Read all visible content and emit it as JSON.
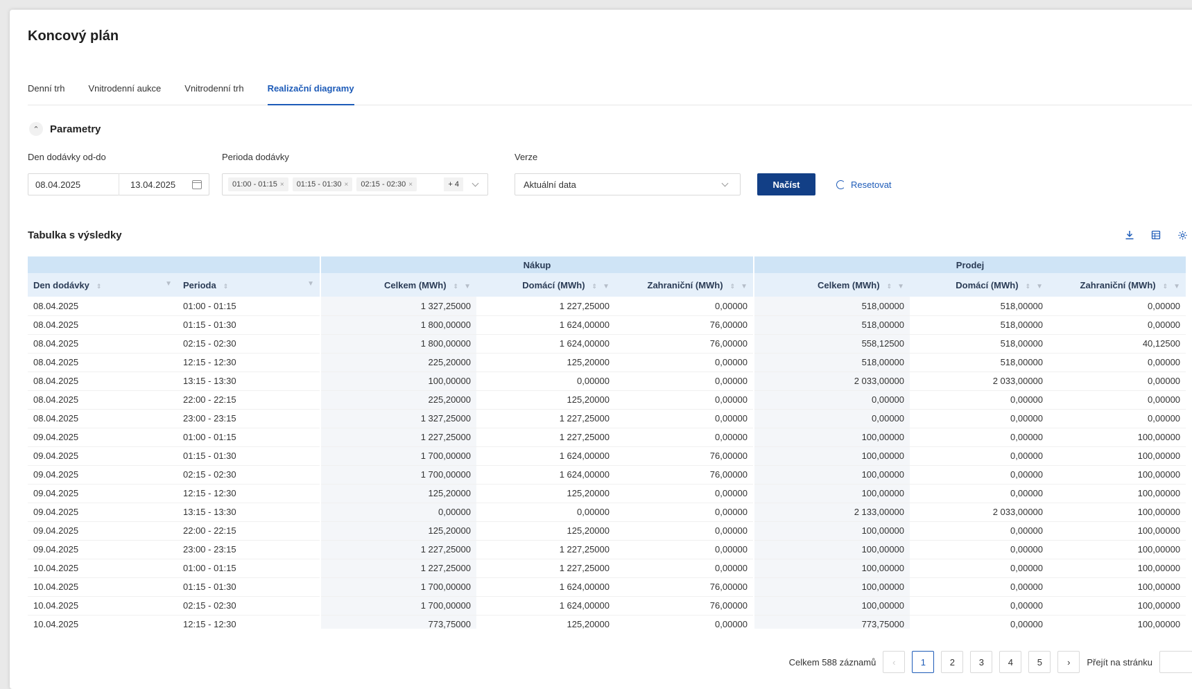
{
  "page": {
    "title": "Koncový plán"
  },
  "tabs": [
    "Denní trh",
    "Vnitrodenní aukce",
    "Vnitrodenní trh",
    "Realizační diagramy"
  ],
  "active_tab": "Realizační diagramy",
  "params": {
    "title": "Parametry",
    "date_label": "Den dodávky od-do",
    "date_from": "08.04.2025",
    "date_to": "13.04.2025",
    "period_label": "Perioda dodávky",
    "period_chips": [
      "01:00 - 01:15",
      "01:15 - 01:30",
      "02:15 - 02:30"
    ],
    "period_more": "+ 4",
    "version_label": "Verze",
    "version_value": "Aktuální data",
    "load_button": "Načíst",
    "reset_button": "Resetovat"
  },
  "results": {
    "title": "Tabulka s výsledky",
    "group_headers": {
      "buy": "Nákup",
      "sell": "Prodej"
    },
    "columns": [
      "Den dodávky",
      "Perioda",
      "Celkem (MWh)",
      "Domácí (MWh)",
      "Zahraniční (MWh)",
      "Celkem (MWh)",
      "Domácí (MWh)",
      "Zahraniční (MWh)"
    ],
    "rows": [
      [
        "08.04.2025",
        "01:00 - 01:15",
        "1 327,25000",
        "1 227,25000",
        "0,00000",
        "518,00000",
        "518,00000",
        "0,00000"
      ],
      [
        "08.04.2025",
        "01:15 - 01:30",
        "1 800,00000",
        "1 624,00000",
        "76,00000",
        "518,00000",
        "518,00000",
        "0,00000"
      ],
      [
        "08.04.2025",
        "02:15 - 02:30",
        "1 800,00000",
        "1 624,00000",
        "76,00000",
        "558,12500",
        "518,00000",
        "40,12500"
      ],
      [
        "08.04.2025",
        "12:15 - 12:30",
        "225,20000",
        "125,20000",
        "0,00000",
        "518,00000",
        "518,00000",
        "0,00000"
      ],
      [
        "08.04.2025",
        "13:15 - 13:30",
        "100,00000",
        "0,00000",
        "0,00000",
        "2 033,00000",
        "2 033,00000",
        "0,00000"
      ],
      [
        "08.04.2025",
        "22:00 - 22:15",
        "225,20000",
        "125,20000",
        "0,00000",
        "0,00000",
        "0,00000",
        "0,00000"
      ],
      [
        "08.04.2025",
        "23:00 - 23:15",
        "1 327,25000",
        "1 227,25000",
        "0,00000",
        "0,00000",
        "0,00000",
        "0,00000"
      ],
      [
        "09.04.2025",
        "01:00 - 01:15",
        "1 227,25000",
        "1 227,25000",
        "0,00000",
        "100,00000",
        "0,00000",
        "100,00000"
      ],
      [
        "09.04.2025",
        "01:15 - 01:30",
        "1 700,00000",
        "1 624,00000",
        "76,00000",
        "100,00000",
        "0,00000",
        "100,00000"
      ],
      [
        "09.04.2025",
        "02:15 - 02:30",
        "1 700,00000",
        "1 624,00000",
        "76,00000",
        "100,00000",
        "0,00000",
        "100,00000"
      ],
      [
        "09.04.2025",
        "12:15 - 12:30",
        "125,20000",
        "125,20000",
        "0,00000",
        "100,00000",
        "0,00000",
        "100,00000"
      ],
      [
        "09.04.2025",
        "13:15 - 13:30",
        "0,00000",
        "0,00000",
        "0,00000",
        "2 133,00000",
        "2 033,00000",
        "100,00000"
      ],
      [
        "09.04.2025",
        "22:00 - 22:15",
        "125,20000",
        "125,20000",
        "0,00000",
        "100,00000",
        "0,00000",
        "100,00000"
      ],
      [
        "09.04.2025",
        "23:00 - 23:15",
        "1 227,25000",
        "1 227,25000",
        "0,00000",
        "100,00000",
        "0,00000",
        "100,00000"
      ],
      [
        "10.04.2025",
        "01:00 - 01:15",
        "1 227,25000",
        "1 227,25000",
        "0,00000",
        "100,00000",
        "0,00000",
        "100,00000"
      ],
      [
        "10.04.2025",
        "01:15 - 01:30",
        "1 700,00000",
        "1 624,00000",
        "76,00000",
        "100,00000",
        "0,00000",
        "100,00000"
      ],
      [
        "10.04.2025",
        "02:15 - 02:30",
        "1 700,00000",
        "1 624,00000",
        "76,00000",
        "100,00000",
        "0,00000",
        "100,00000"
      ],
      [
        "10.04.2025",
        "12:15 - 12:30",
        "773,75000",
        "125,20000",
        "0,00000",
        "773,75000",
        "0,00000",
        "100,00000"
      ]
    ]
  },
  "pagination": {
    "total_text": "Celkem 588 záznamů",
    "pages": [
      "1",
      "2",
      "3",
      "4",
      "5"
    ],
    "current": "1",
    "jump_label": "Přejít na stránku"
  }
}
